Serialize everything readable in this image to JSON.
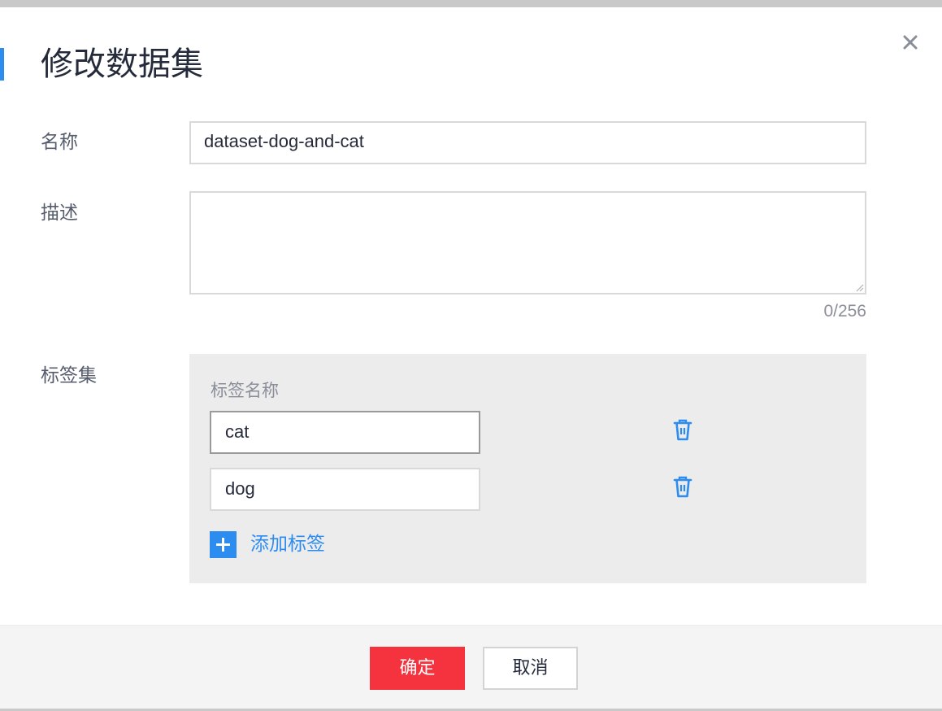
{
  "dialog": {
    "title": "修改数据集",
    "close_icon": "close-icon"
  },
  "form": {
    "name_label": "名称",
    "name_value": "dataset-dog-and-cat",
    "description_label": "描述",
    "description_value": "",
    "description_count": "0/256",
    "labels_label": "标签集"
  },
  "tags": {
    "column_header": "标签名称",
    "items": [
      {
        "value": "cat",
        "delete_icon": "trash-icon",
        "focused": true
      },
      {
        "value": "dog",
        "delete_icon": "trash-icon",
        "focused": false
      }
    ],
    "add_label": "添加标签",
    "add_icon": "plus-icon"
  },
  "footer": {
    "ok_label": "确定",
    "cancel_label": "取消"
  },
  "colors": {
    "accent": "#2d8cf0",
    "primary_button": "#f4333f",
    "panel_background": "#ececec"
  }
}
